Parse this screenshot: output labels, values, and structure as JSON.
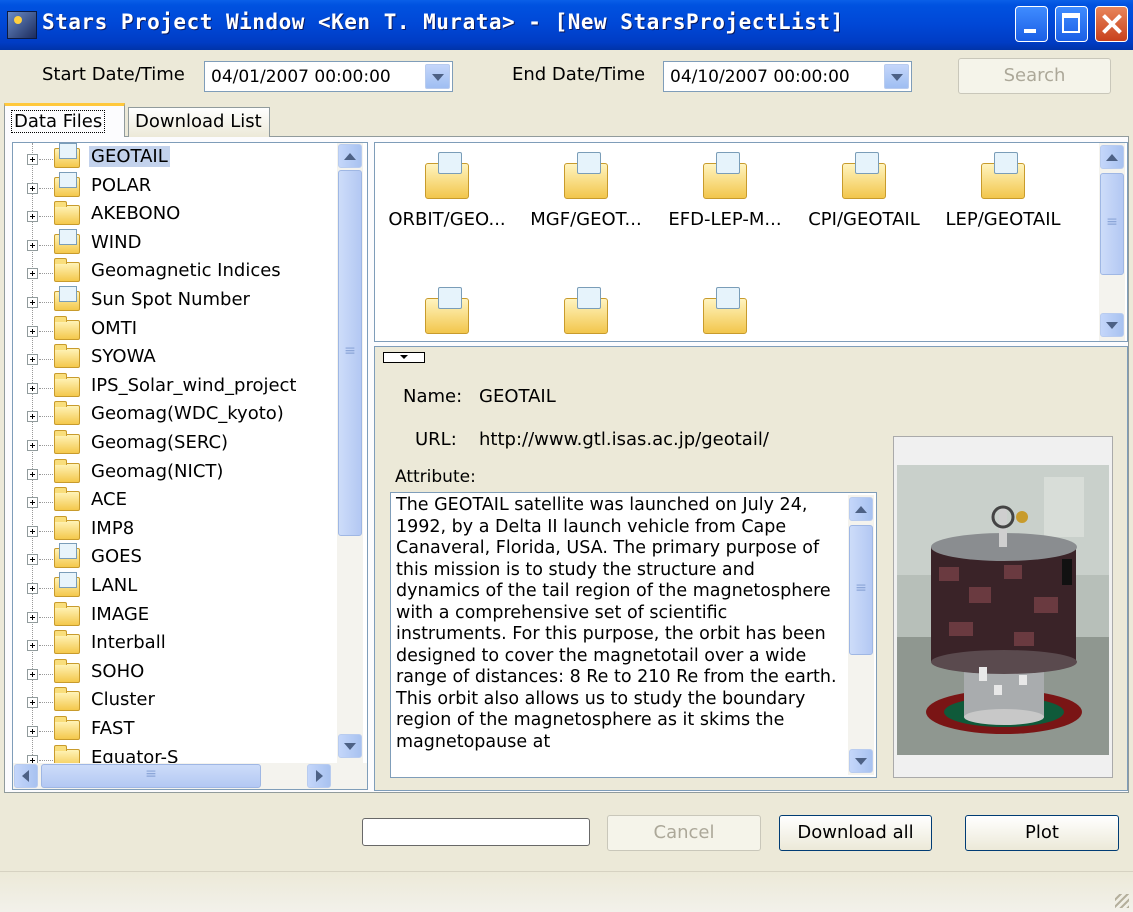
{
  "window": {
    "title": "Stars Project Window <Ken T. Murata> - [New StarsProjectList]"
  },
  "search_bar": {
    "start_label": "Start Date/Time",
    "start_value": "04/01/2007 00:00:00",
    "end_label": "End Date/Time",
    "end_value": "04/10/2007 00:00:00",
    "search_label": "Search"
  },
  "tabs": [
    "Data Files",
    "Download List"
  ],
  "tree": {
    "items": [
      {
        "label": "GEOTAIL",
        "icon": "document-folder-icon",
        "selected": true
      },
      {
        "label": "POLAR",
        "icon": "document-folder-icon"
      },
      {
        "label": "AKEBONO",
        "icon": "folder-icon"
      },
      {
        "label": "WIND",
        "icon": "document-folder-icon"
      },
      {
        "label": "Geomagnetic Indices",
        "icon": "folder-icon"
      },
      {
        "label": "Sun Spot Number",
        "icon": "document-folder-icon"
      },
      {
        "label": "OMTI",
        "icon": "folder-icon"
      },
      {
        "label": "SYOWA",
        "icon": "folder-icon"
      },
      {
        "label": "IPS_Solar_wind_project",
        "icon": "folder-icon"
      },
      {
        "label": "Geomag(WDC_kyoto)",
        "icon": "folder-icon"
      },
      {
        "label": "Geomag(SERC)",
        "icon": "folder-icon"
      },
      {
        "label": "Geomag(NICT)",
        "icon": "folder-icon"
      },
      {
        "label": "ACE",
        "icon": "folder-icon"
      },
      {
        "label": "IMP8",
        "icon": "folder-icon"
      },
      {
        "label": "GOES",
        "icon": "document-folder-icon"
      },
      {
        "label": "LANL",
        "icon": "document-folder-icon"
      },
      {
        "label": "IMAGE",
        "icon": "folder-icon"
      },
      {
        "label": "Interball",
        "icon": "folder-icon"
      },
      {
        "label": "SOHO",
        "icon": "folder-icon"
      },
      {
        "label": "Cluster",
        "icon": "folder-icon"
      },
      {
        "label": "FAST",
        "icon": "folder-icon"
      },
      {
        "label": "Equator-S",
        "icon": "folder-icon"
      }
    ]
  },
  "files": {
    "items": [
      {
        "label": "ORBIT/GEO..."
      },
      {
        "label": "MGF/GEOT..."
      },
      {
        "label": "EFD-LEP-M..."
      },
      {
        "label": "CPI/GEOTAIL"
      },
      {
        "label": "LEP/GEOTAIL"
      },
      {
        "label": ""
      },
      {
        "label": ""
      },
      {
        "label": ""
      }
    ]
  },
  "details": {
    "name_label": "Name:",
    "name_value": "GEOTAIL",
    "url_label": "URL:",
    "url_value": "http://www.gtl.isas.ac.jp/geotail/",
    "attribute_label": "Attribute:",
    "attribute_text": "The GEOTAIL satellite was launched on July 24, 1992, by a Delta II launch vehicle from Cape Canaveral, Florida, USA. The primary purpose of this mission is to study the structure and dynamics of the tail region of the magnetosphere with a comprehensive set of scientific instruments. For this purpose, the orbit has been designed to cover the magnetotail over a wide range of distances: 8 Re to 210 Re from the earth. This orbit also allows us to study the boundary region of the magnetosphere as it skims the magnetopause at"
  },
  "bottom": {
    "cancel_label": "Cancel",
    "download_all_label": "Download all",
    "plot_label": "Plot"
  }
}
